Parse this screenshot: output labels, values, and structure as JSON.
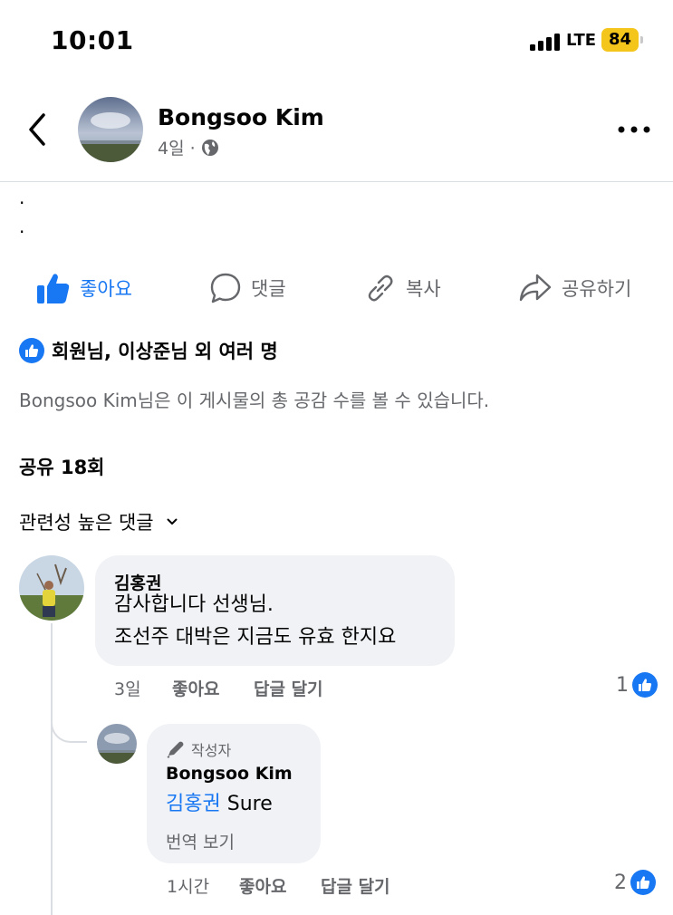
{
  "status_bar": {
    "time": "10:01",
    "network": "LTE",
    "battery": "84"
  },
  "header": {
    "author_name": "Bongsoo Kim",
    "post_age": "4일 ·"
  },
  "post": {
    "body_lines": [
      ".",
      "."
    ]
  },
  "actions": {
    "like": "좋아요",
    "comment": "댓글",
    "copy": "복사",
    "share": "공유하기"
  },
  "reactions": {
    "summary": "회원님, 이상준님 외 여러 명",
    "visibility_note": "Bongsoo Kim님은 이 게시물의 총 공감 수를 볼 수 있습니다."
  },
  "shares": "공유 18회",
  "sort": {
    "label": "관련성 높은 댓글"
  },
  "comments": [
    {
      "author": "김홍권",
      "lines": [
        "감사합니다 선생님.",
        "조선주 대박은 지금도 유효 한지요"
      ],
      "time": "3일",
      "like_label": "좋아요",
      "reply_label": "답글 달기",
      "like_count": "1"
    },
    {
      "author_tag": "작성자",
      "author": "Bongsoo Kim",
      "mention": "김홍권",
      "text": " Sure",
      "translate_label": "번역 보기",
      "time": "1시간",
      "like_label": "좋아요",
      "reply_label": "답글 달기",
      "like_count": "2"
    }
  ],
  "colors": {
    "accent": "#1877f2",
    "secondary_text": "#65676b",
    "bubble": "#f0f2f5",
    "battery": "#f4c51a"
  }
}
